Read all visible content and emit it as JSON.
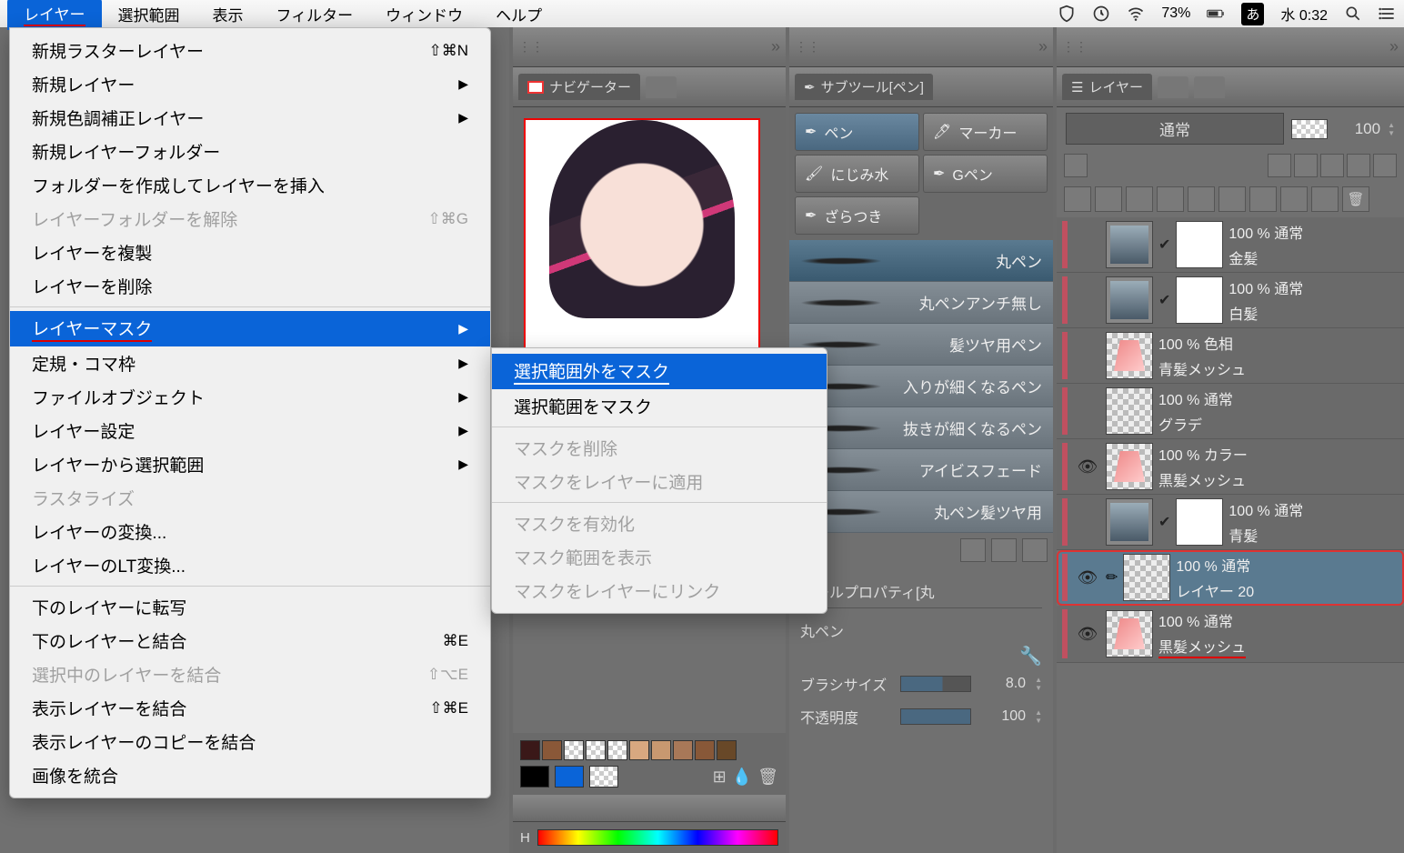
{
  "menubar": {
    "items": [
      "レイヤー",
      "選択範囲",
      "表示",
      "フィルター",
      "ウィンドウ",
      "ヘルプ"
    ],
    "battery": "73%",
    "ime": "あ",
    "clock": "水 0:32"
  },
  "dropdown": {
    "items": [
      {
        "label": "新規ラスターレイヤー",
        "shortcut": "⇧⌘N"
      },
      {
        "label": "新規レイヤー",
        "arrow": true
      },
      {
        "label": "新規色調補正レイヤー",
        "arrow": true
      },
      {
        "label": "新規レイヤーフォルダー"
      },
      {
        "label": "フォルダーを作成してレイヤーを挿入"
      },
      {
        "label": "レイヤーフォルダーを解除",
        "shortcut": "⇧⌘G",
        "disabled": true
      },
      {
        "label": "レイヤーを複製"
      },
      {
        "label": "レイヤーを削除"
      },
      {
        "sep": true
      },
      {
        "label": "レイヤーマスク",
        "arrow": true,
        "highlighted": true,
        "underline": true
      },
      {
        "label": "定規・コマ枠",
        "arrow": true
      },
      {
        "label": "ファイルオブジェクト",
        "arrow": true
      },
      {
        "label": "レイヤー設定",
        "arrow": true
      },
      {
        "label": "レイヤーから選択範囲",
        "arrow": true
      },
      {
        "label": "ラスタライズ",
        "disabled": true
      },
      {
        "label": "レイヤーの変換..."
      },
      {
        "label": "レイヤーのLT変換..."
      },
      {
        "sep": true
      },
      {
        "label": "下のレイヤーに転写"
      },
      {
        "label": "下のレイヤーと結合",
        "shortcut": "⌘E"
      },
      {
        "label": "選択中のレイヤーを結合",
        "shortcut": "⇧⌥E",
        "disabled": true
      },
      {
        "label": "表示レイヤーを結合",
        "shortcut": "⇧⌘E"
      },
      {
        "label": "表示レイヤーのコピーを結合"
      },
      {
        "label": "画像を統合"
      }
    ]
  },
  "submenu": {
    "items": [
      {
        "label": "選択範囲外をマスク",
        "highlighted": true,
        "underline": true
      },
      {
        "label": "選択範囲をマスク"
      },
      {
        "sep": true
      },
      {
        "label": "マスクを削除",
        "disabled": true
      },
      {
        "label": "マスクをレイヤーに適用",
        "disabled": true
      },
      {
        "sep": true
      },
      {
        "label": "マスクを有効化",
        "disabled": true
      },
      {
        "label": "マスク範囲を表示",
        "disabled": true
      },
      {
        "label": "マスクをレイヤーにリンク",
        "disabled": true
      }
    ]
  },
  "navigator": {
    "tab": "ナビゲーター"
  },
  "subtool": {
    "title": "サブツール[ペン]",
    "buttons": [
      {
        "label": "ペン",
        "active": true
      },
      {
        "label": "マーカー"
      },
      {
        "label": "にじみ水"
      },
      {
        "label": "Gペン"
      },
      {
        "label": "ざらつき"
      }
    ],
    "pens": [
      "丸ペン",
      "丸ペンアンチ無し",
      "髪ツヤ用ペン",
      "入りが細くなるペン",
      "抜きが細くなるペン",
      "アイビスフェード",
      "丸ペン髪ツヤ用"
    ]
  },
  "toolprop": {
    "title": "ツールプロパティ[丸",
    "name": "丸ペン",
    "rows": [
      {
        "label": "ブラシサイズ",
        "value": "8.0"
      },
      {
        "label": "不透明度",
        "value": "100"
      }
    ]
  },
  "layerpanel": {
    "tab": "レイヤー",
    "blend": "通常",
    "opacity": "100",
    "layers": [
      {
        "opacity": "100 %",
        "blend": "通常",
        "name": "金髪",
        "mask": true,
        "thumb": "img"
      },
      {
        "opacity": "100 %",
        "blend": "通常",
        "name": "白髪",
        "mask": true,
        "thumb": "img"
      },
      {
        "opacity": "100 %",
        "blend": "色相",
        "name": "青髪メッシュ",
        "thumb": "checker-stroke"
      },
      {
        "opacity": "100 %",
        "blend": "通常",
        "name": "グラデ",
        "thumb": "checker-grad"
      },
      {
        "opacity": "100 %",
        "blend": "カラー",
        "name": "黒髪メッシュ",
        "vis": true,
        "thumb": "checker-stroke"
      },
      {
        "opacity": "100 %",
        "blend": "通常",
        "name": "青髪",
        "mask": true,
        "thumb": "img"
      },
      {
        "opacity": "100 %",
        "blend": "通常",
        "name": "レイヤー 20",
        "vis": true,
        "selected": true,
        "thumb": "checker"
      },
      {
        "opacity": "100 %",
        "blend": "通常",
        "name": "黒髪メッシュ",
        "vis": true,
        "thumb": "checker-stroke",
        "underline": true
      }
    ]
  },
  "hsv": {
    "label": "H"
  }
}
